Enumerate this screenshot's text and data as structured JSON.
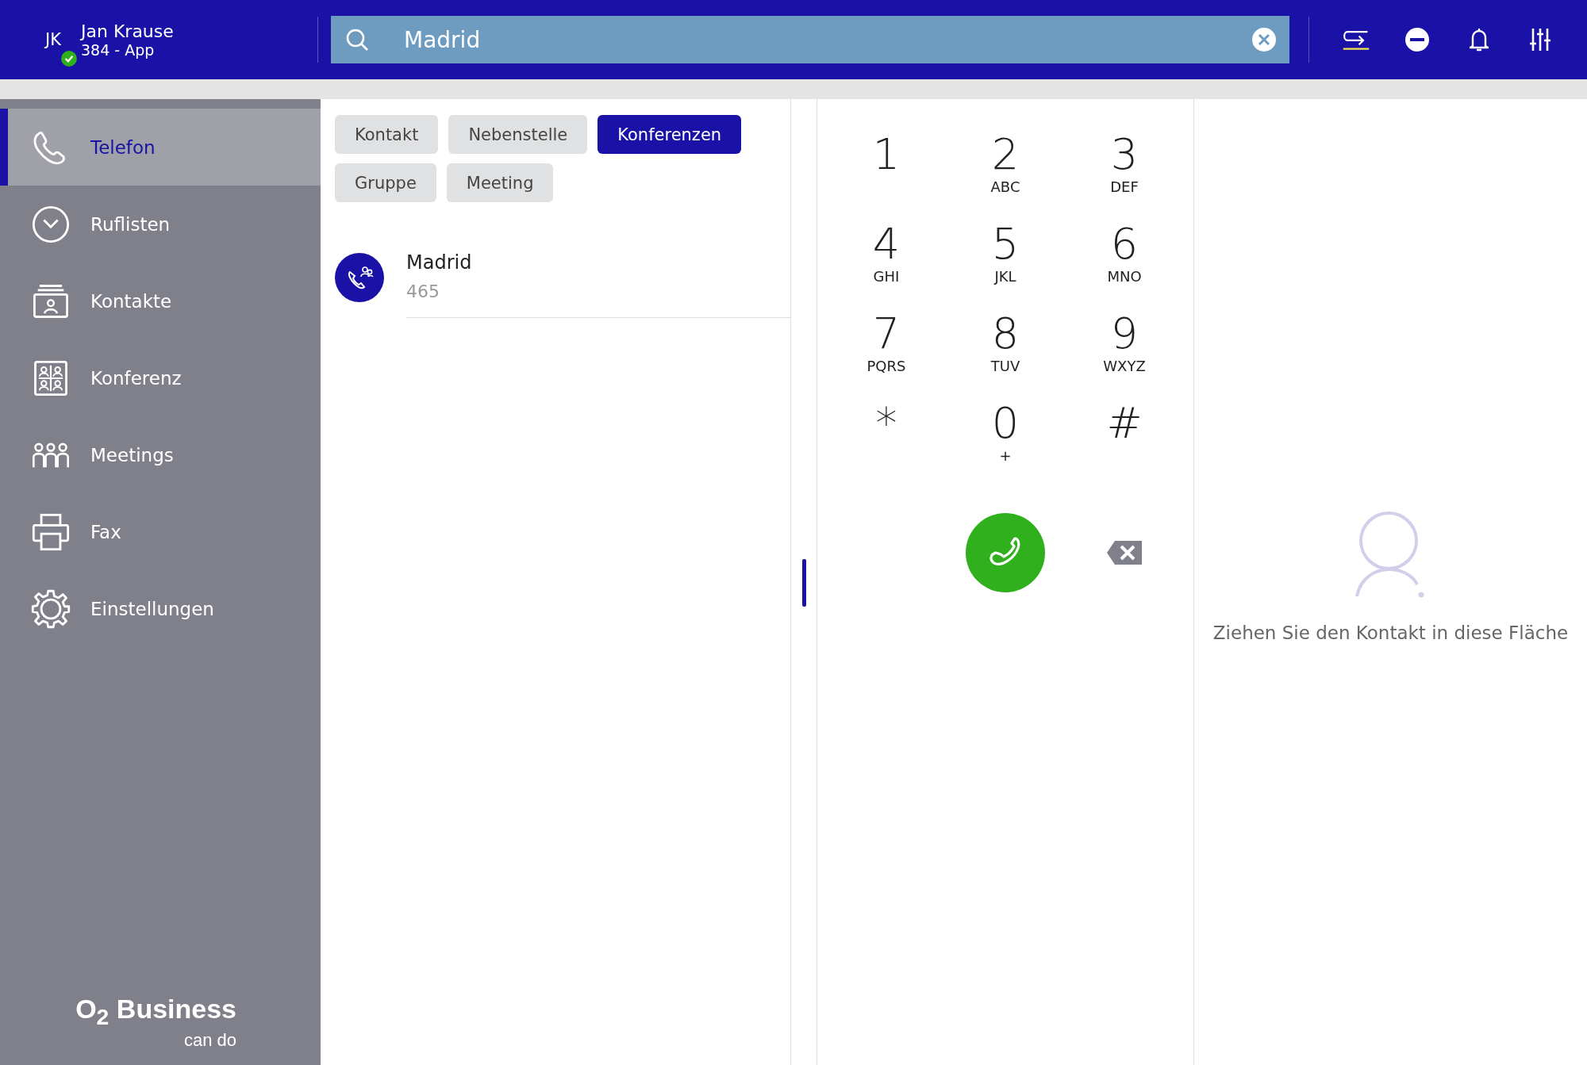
{
  "user": {
    "initials": "JK",
    "name": "Jan Krause",
    "extension": "384 - App",
    "online": true
  },
  "search": {
    "value": "Madrid"
  },
  "sidebar": {
    "items": [
      {
        "label": "Telefon",
        "selected": true
      },
      {
        "label": "Ruflisten",
        "selected": false
      },
      {
        "label": "Kontakte",
        "selected": false
      },
      {
        "label": "Konferenz",
        "selected": false
      },
      {
        "label": "Meetings",
        "selected": false
      },
      {
        "label": "Fax",
        "selected": false
      },
      {
        "label": "Einstellungen",
        "selected": false
      }
    ]
  },
  "logo": {
    "brand": "O$_{2}$ Business",
    "tagline": "can do"
  },
  "filters": [
    {
      "label": "Kontakt",
      "selected": false
    },
    {
      "label": "Nebenstelle",
      "selected": false
    },
    {
      "label": "Konferenzen",
      "selected": true
    },
    {
      "label": "Gruppe",
      "selected": false
    },
    {
      "label": "Meeting",
      "selected": false
    }
  ],
  "results": [
    {
      "name": "Madrid",
      "number": "465"
    }
  ],
  "dialpad": {
    "keys": [
      {
        "digit": "1"
      },
      {
        "digit": "2",
        "letters": "ABC"
      },
      {
        "digit": "3",
        "letters": "DEF"
      },
      {
        "digit": "4",
        "letters": "GHI"
      },
      {
        "digit": "5",
        "letters": "JKL"
      },
      {
        "digit": "6",
        "letters": "MNO"
      },
      {
        "digit": "7",
        "letters": "PQRS"
      },
      {
        "digit": "8",
        "letters": "TUV"
      },
      {
        "digit": "9",
        "letters": "WXYZ"
      },
      {
        "digit": "*"
      },
      {
        "digit": "0",
        "letters": "+"
      },
      {
        "digit": "#"
      }
    ]
  },
  "drop_zone": {
    "hint": "Ziehen Sie den Kontakt in diese Fläche"
  }
}
